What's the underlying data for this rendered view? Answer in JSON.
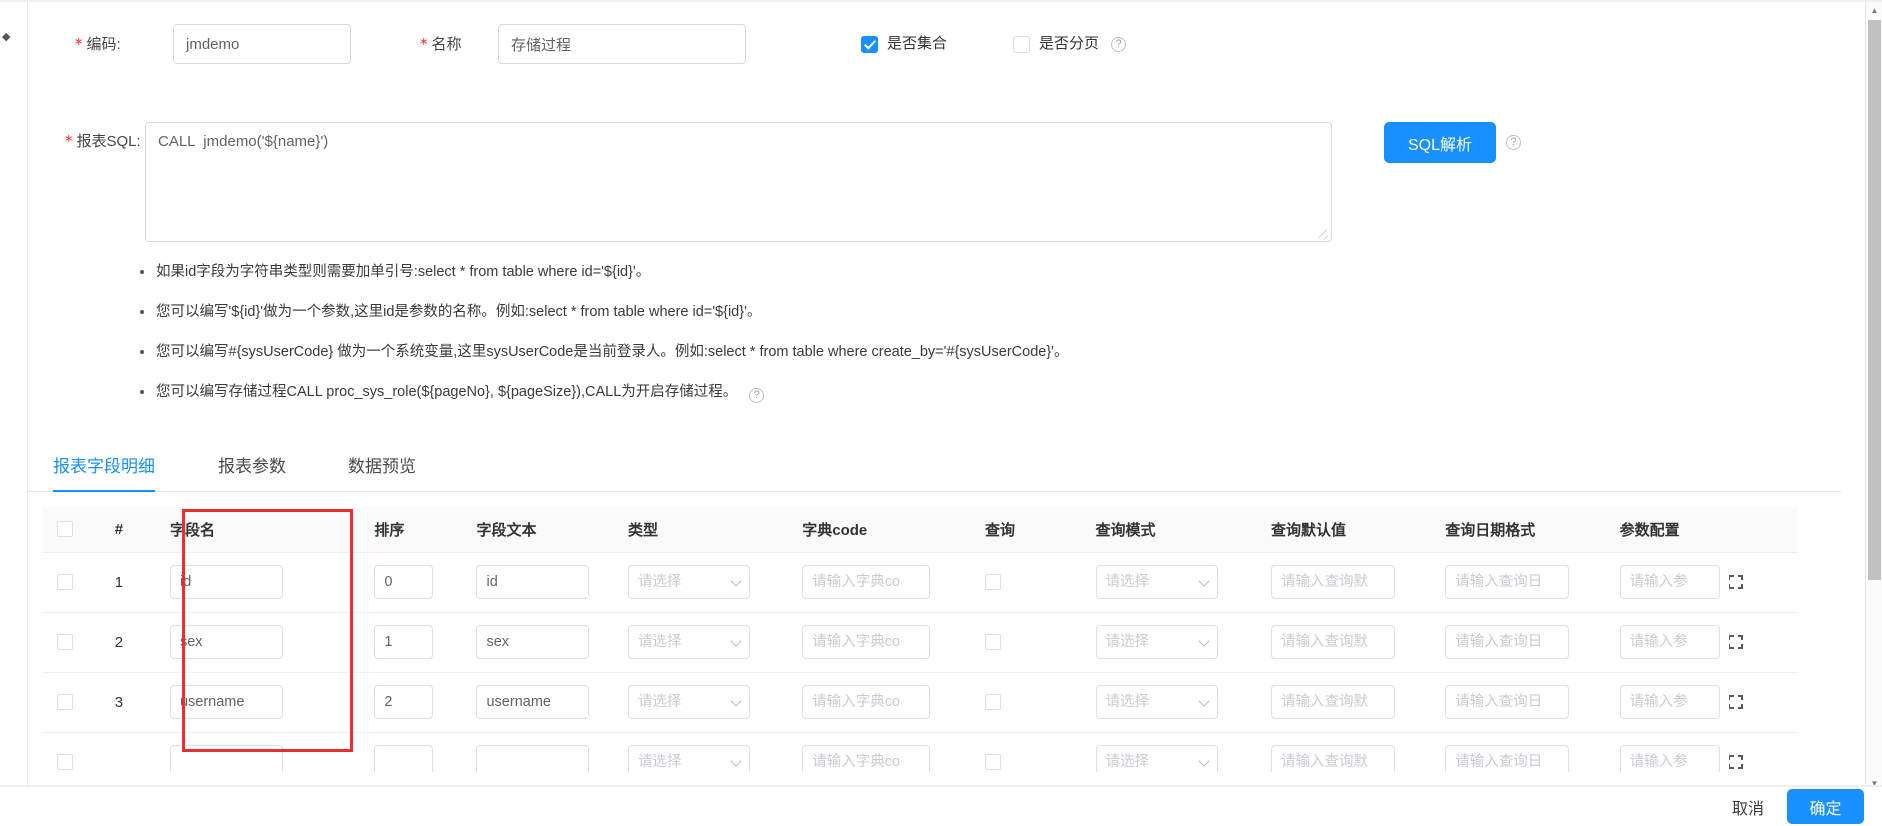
{
  "form": {
    "code": {
      "label": "编码:",
      "required": true,
      "value": "jmdemo"
    },
    "name": {
      "label": "名称",
      "required": true,
      "value": "存储过程"
    },
    "is_aggregate": {
      "label": "是否集合",
      "checked": true
    },
    "is_paging": {
      "label": "是否分页",
      "checked": false
    },
    "sql": {
      "label": "报表SQL:",
      "required": true,
      "value": "CALL  jmdemo('${name}')"
    },
    "sql_parse_button": "SQL解析"
  },
  "tips": [
    "如果id字段为字符串类型则需要加单引号:select * from table where id='${id}'。",
    "您可以编写'${id}'做为一个参数,这里id是参数的名称。例如:select * from table where id='${id}'。",
    "您可以编写#{sysUserCode} 做为一个系统变量,这里sysUserCode是当前登录人。例如:select * from table where create_by='#{sysUserCode}'。",
    "您可以编写存储过程CALL proc_sys_role(${pageNo}, ${pageSize}),CALL为开启存储过程。"
  ],
  "tabs": [
    {
      "label": "报表字段明细",
      "active": true
    },
    {
      "label": "报表参数",
      "active": false
    },
    {
      "label": "数据预览",
      "active": false
    }
  ],
  "table": {
    "headers": [
      "",
      "#",
      "字段名",
      "排序",
      "字段文本",
      "类型",
      "字典code",
      "查询",
      "查询模式",
      "查询默认值",
      "查询日期格式",
      "参数配置"
    ],
    "placeholders": {
      "type": "请选择",
      "dict_code": "请输入字典co",
      "query_mode": "请选择",
      "query_default": "请输入查询默",
      "query_date_format": "请输入查询日",
      "param_config": "请输入参"
    },
    "rows": [
      {
        "index": "1",
        "field_name": "id",
        "order": "0",
        "field_text": "id",
        "checked": false
      },
      {
        "index": "2",
        "field_name": "sex",
        "order": "1",
        "field_text": "sex",
        "checked": false
      },
      {
        "index": "3",
        "field_name": "username",
        "order": "2",
        "field_text": "username",
        "checked": false
      }
    ]
  },
  "footer": {
    "cancel": "取消",
    "confirm": "确定"
  },
  "icons": {
    "help": "?",
    "chevron_down": "chevron-down-icon",
    "scroll_up": "▲",
    "scroll_down": "▼",
    "left_caret": "◆"
  },
  "colors": {
    "primary": "#1890ff",
    "required_star": "#f5222d",
    "annotation": "#e8312f",
    "header_bg": "#fafafa",
    "border": "#dcdfe6"
  }
}
